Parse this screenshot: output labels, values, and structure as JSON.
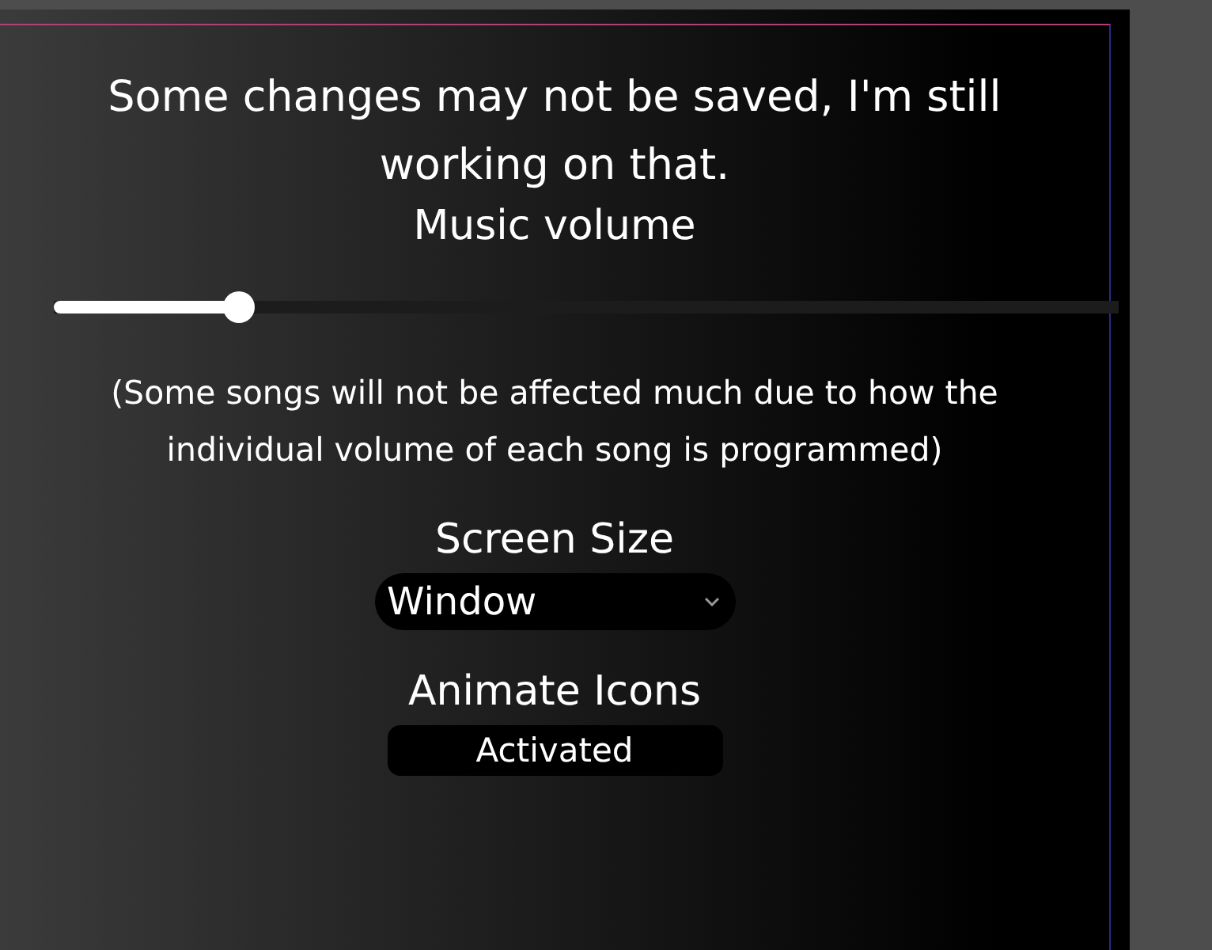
{
  "notice": "Some changes may not be saved, I'm still working on that.",
  "music_volume": {
    "label": "Music volume",
    "level": 0.164
  },
  "volume_note": "(Some songs will not be affected much due to how the individual volume of each song is programmed)",
  "screen_size": {
    "label": "Screen Size",
    "value": "Window"
  },
  "animate_icons": {
    "label": "Animate Icons",
    "button": "Activated"
  }
}
